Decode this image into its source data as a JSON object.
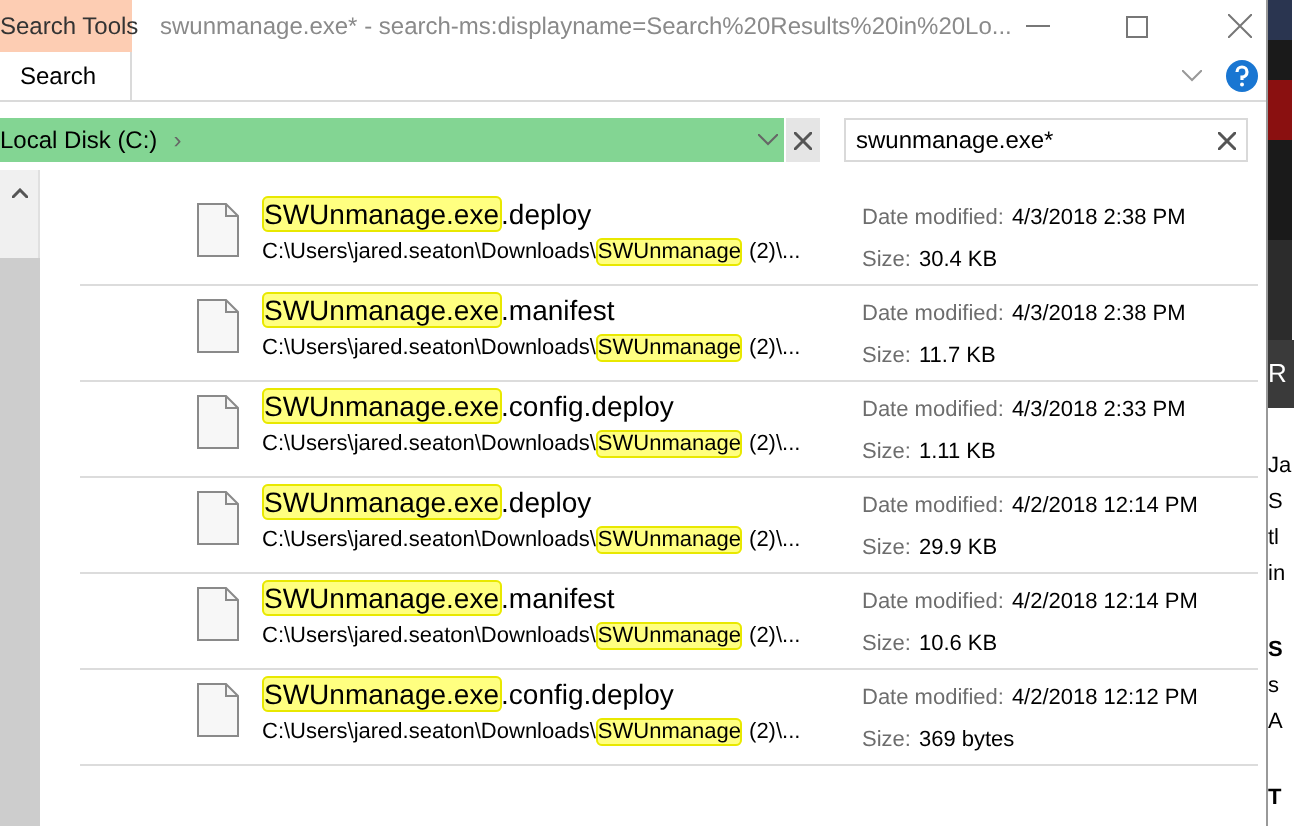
{
  "ribbon": {
    "context_tab": "Search Tools",
    "tabs": [
      {
        "label": "Search",
        "selected": true
      }
    ]
  },
  "window": {
    "title": "swunmanage.exe* - search-ms:displayname=Search%20Results%20in%20Lo..."
  },
  "address_bar": {
    "location": "Local Disk (C:)",
    "separator": "›"
  },
  "search": {
    "value": "swunmanage.exe*"
  },
  "results": [
    {
      "name_match": "SWUnmanage.exe",
      "name_rest": ".deploy",
      "path_prefix": "C:\\Users\\jared.seaton\\Downloads\\",
      "path_match": "SWUnmanage",
      "path_suffix": " (2)\\...",
      "date_label": "Date modified:",
      "date": "4/3/2018 2:38 PM",
      "size_label": "Size:",
      "size": "30.4 KB"
    },
    {
      "name_match": "SWUnmanage.exe",
      "name_rest": ".manifest",
      "path_prefix": "C:\\Users\\jared.seaton\\Downloads\\",
      "path_match": "SWUnmanage",
      "path_suffix": " (2)\\...",
      "date_label": "Date modified:",
      "date": "4/3/2018 2:38 PM",
      "size_label": "Size:",
      "size": "11.7 KB"
    },
    {
      "name_match": "SWUnmanage.exe",
      "name_rest": ".config.deploy",
      "path_prefix": "C:\\Users\\jared.seaton\\Downloads\\",
      "path_match": "SWUnmanage",
      "path_suffix": " (2)\\...",
      "date_label": "Date modified:",
      "date": "4/3/2018 2:33 PM",
      "size_label": "Size:",
      "size": "1.11 KB"
    },
    {
      "name_match": "SWUnmanage.exe",
      "name_rest": ".deploy",
      "path_prefix": "C:\\Users\\jared.seaton\\Downloads\\",
      "path_match": "SWUnmanage",
      "path_suffix": " (2)\\...",
      "date_label": "Date modified:",
      "date": "4/2/2018 12:14 PM",
      "size_label": "Size:",
      "size": "29.9 KB"
    },
    {
      "name_match": "SWUnmanage.exe",
      "name_rest": ".manifest",
      "path_prefix": "C:\\Users\\jared.seaton\\Downloads\\",
      "path_match": "SWUnmanage",
      "path_suffix": " (2)\\...",
      "date_label": "Date modified:",
      "date": "4/2/2018 12:14 PM",
      "size_label": "Size:",
      "size": "10.6 KB"
    },
    {
      "name_match": "SWUnmanage.exe",
      "name_rest": ".config.deploy",
      "path_prefix": "C:\\Users\\jared.seaton\\Downloads\\",
      "path_match": "SWUnmanage",
      "path_suffix": " (2)\\...",
      "date_label": "Date modified:",
      "date": "4/2/2018 12:12 PM",
      "size_label": "Size:",
      "size": "369 bytes"
    }
  ],
  "background_window": {
    "bar_text": "R",
    "fragments": [
      "Ja",
      "S",
      "tl",
      "in",
      "S",
      "s",
      "A",
      "T"
    ]
  }
}
